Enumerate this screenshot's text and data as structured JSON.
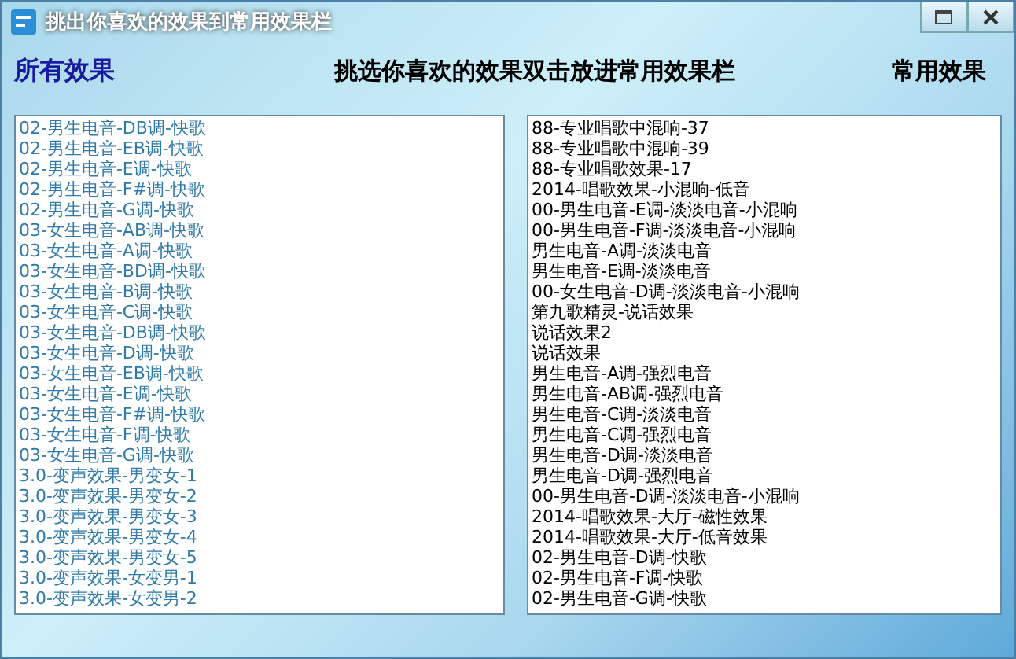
{
  "window": {
    "title": "挑出你喜欢的效果到常用效果栏"
  },
  "header": {
    "left_label": "所有效果",
    "instruction": "挑选你喜欢的效果双击放进常用效果栏",
    "right_label": "常用效果"
  },
  "all_effects": [
    "02-男生电音-DB调-快歌",
    "02-男生电音-EB调-快歌",
    "02-男生电音-E调-快歌",
    "02-男生电音-F#调-快歌",
    "02-男生电音-G调-快歌",
    "03-女生电音-AB调-快歌",
    "03-女生电音-A调-快歌",
    "03-女生电音-BD调-快歌",
    "03-女生电音-B调-快歌",
    "03-女生电音-C调-快歌",
    "03-女生电音-DB调-快歌",
    "03-女生电音-D调-快歌",
    "03-女生电音-EB调-快歌",
    "03-女生电音-E调-快歌",
    "03-女生电音-F#调-快歌",
    "03-女生电音-F调-快歌",
    "03-女生电音-G调-快歌",
    "3.0-变声效果-男变女-1",
    "3.0-变声效果-男变女-2",
    "3.0-变声效果-男变女-3",
    "3.0-变声效果-男变女-4",
    "3.0-变声效果-男变女-5",
    "3.0-变声效果-女变男-1",
    "3.0-变声效果-女变男-2"
  ],
  "favorite_effects": [
    "88-专业唱歌中混响-37",
    "88-专业唱歌中混响-39",
    "88-专业唱歌效果-17",
    "2014-唱歌效果-小混响-低音",
    "00-男生电音-E调-淡淡电音-小混响",
    "00-男生电音-F调-淡淡电音-小混响",
    "男生电音-A调-淡淡电音",
    "男生电音-E调-淡淡电音",
    "00-女生电音-D调-淡淡电音-小混响",
    "第九歌精灵-说话效果",
    "说话效果2",
    "说话效果",
    "男生电音-A调-强烈电音",
    "男生电音-AB调-强烈电音",
    "男生电音-C调-淡淡电音",
    "男生电音-C调-强烈电音",
    "男生电音-D调-淡淡电音",
    "男生电音-D调-强烈电音",
    "00-男生电音-D调-淡淡电音-小混响",
    "2014-唱歌效果-大厅-磁性效果",
    "2014-唱歌效果-大厅-低音效果",
    "02-男生电音-D调-快歌",
    "02-男生电音-F调-快歌",
    "02-男生电音-G调-快歌"
  ]
}
